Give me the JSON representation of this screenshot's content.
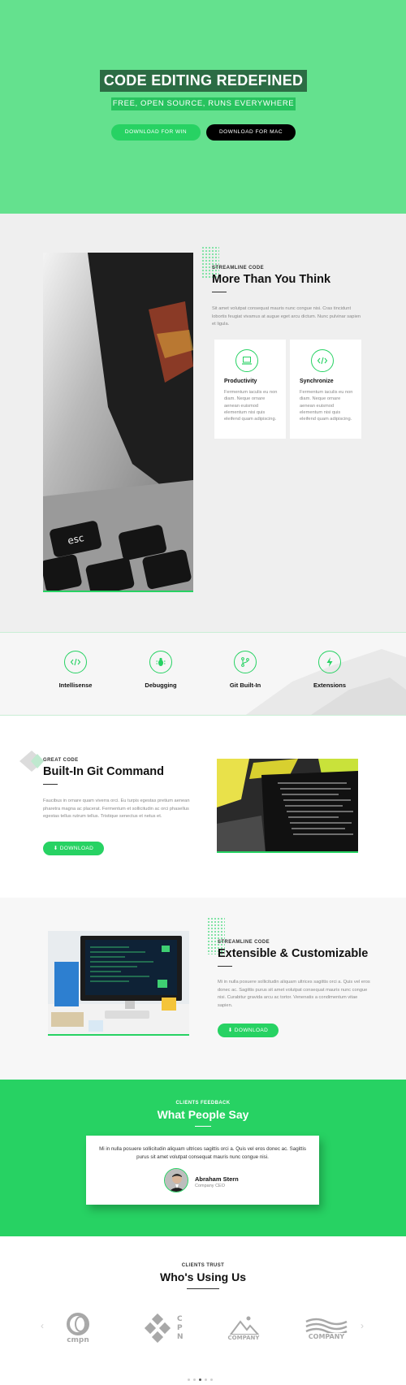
{
  "hero": {
    "title": "CODE EDITING REDEFINED",
    "subtitle": "FREE, OPEN SOURCE, RUNS EVERYWHERE",
    "btn_win": "DOWNLOAD FOR WIN",
    "btn_mac": "DOWNLOAD FOR MAC"
  },
  "section_more": {
    "eyebrow": "STREAMLINE CODE",
    "title": "More Than You Think",
    "text": "Sit amet volutpat consequat mauris nunc congue nisi. Cras tincidunt lobortis feugiat vivamus at augue eget arcu dictum. Nunc pulvinar sapien et ligula.",
    "cards": [
      {
        "title": "Productivity",
        "text": "Fermentum iaculis eu non diam. Neque ornare aenean euismod elementum nisi quis eleifend quam adipiscing.",
        "icon": "laptop-icon"
      },
      {
        "title": "Synchronize",
        "text": "Fermentum iaculis eu non diam. Neque ornare aenean euismod elementum nisi quis eleifend quam adipiscing.",
        "icon": "code-icon"
      }
    ]
  },
  "features": [
    {
      "label": "Intellisense",
      "icon": "code-icon"
    },
    {
      "label": "Debugging",
      "icon": "bug-icon"
    },
    {
      "label": "Git Built-In",
      "icon": "git-branch-icon"
    },
    {
      "label": "Extensions",
      "icon": "bolt-icon"
    }
  ],
  "section_git": {
    "eyebrow": "GREAT CODE",
    "title": "Built-In Git Command",
    "text": "Faucibus in ornare quam viverra orci. Eu turpis egestas pretium aenean pharetra magna ac placerat. Fermentum et sollicitudin ac orci phasellus egestas tellus rutrum tellus. Tristique senectus et netus et.",
    "button": "DOWNLOAD"
  },
  "section_ext": {
    "eyebrow": "STREAMLINE CODE",
    "title": "Extensible & Customizable",
    "text": "Mi in nulla posuere sollicitudin aliquam ultrices sagittis orci a. Quis vel eros donec ac. Sagittis purus sit amet volutpat consequat mauris nunc congue nisi. Curabitur gravida arcu ac tortor. Venenatis a condimentum vitae sapien.",
    "button": "DOWNLOAD"
  },
  "testimonial": {
    "eyebrow": "CLIENTS FEEDBACK",
    "title": "What People Say",
    "quote": "Mi in nulla posuere sollicitudin aliquam ultrices sagittis orci a. Quis vel eros donec ac. Sagittis purus sit amet volutpat consequat mauris nunc congue nisi.",
    "name": "Abraham Stern",
    "role": "Company CEO"
  },
  "clients": {
    "eyebrow": "CLIENTS TRUST",
    "title": "Who's Using Us",
    "logos": [
      "cmpn",
      "CPN",
      "COMPANY",
      "COMPANY"
    ],
    "prev": "‹",
    "next": "›"
  },
  "colors": {
    "accent": "#27d263",
    "hero_bg": "#64e18e",
    "hero_title_bg": "#2c6c44"
  }
}
